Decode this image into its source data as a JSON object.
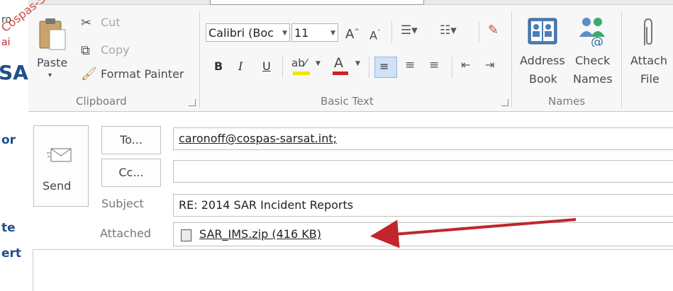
{
  "left_strip": {
    "partial_texts": [
      "ro",
      "ai",
      "SA",
      "or",
      "te",
      "ert",
      "er"
    ],
    "watermark": "Cospas-Sarsat Copy"
  },
  "clipboard": {
    "paste_label": "Paste",
    "cut_label": "Cut",
    "copy_label": "Copy",
    "format_painter_label": "Format Painter",
    "group_label": "Clipboard"
  },
  "basic_text": {
    "font_name": "Calibri (Boc",
    "font_size": "11",
    "bold": "B",
    "italic": "I",
    "underline": "U",
    "group_label": "Basic Text"
  },
  "names": {
    "address_book_line1": "Address",
    "address_book_line2": "Book",
    "check_names_line1": "Check",
    "check_names_line2": "Names",
    "group_label": "Names"
  },
  "include": {
    "attach_line1": "Attach",
    "attach_line2": "File"
  },
  "send": {
    "label": "Send"
  },
  "header": {
    "to_button": "To...",
    "cc_button": "Cc...",
    "subject_label": "Subject",
    "attached_label": "Attached",
    "to_value": "caronoff@cospas-sarsat.int;",
    "cc_value": "",
    "subject_value": "RE: 2014 SAR Incident Reports",
    "attachment_name": "SAR_IMS.zip (416 KB)"
  },
  "colors": {
    "highlight_yellow": "#f2e600",
    "font_red": "#d11f1f",
    "arrow_red": "#c0262c",
    "selected_blue": "#cfe2f7"
  }
}
